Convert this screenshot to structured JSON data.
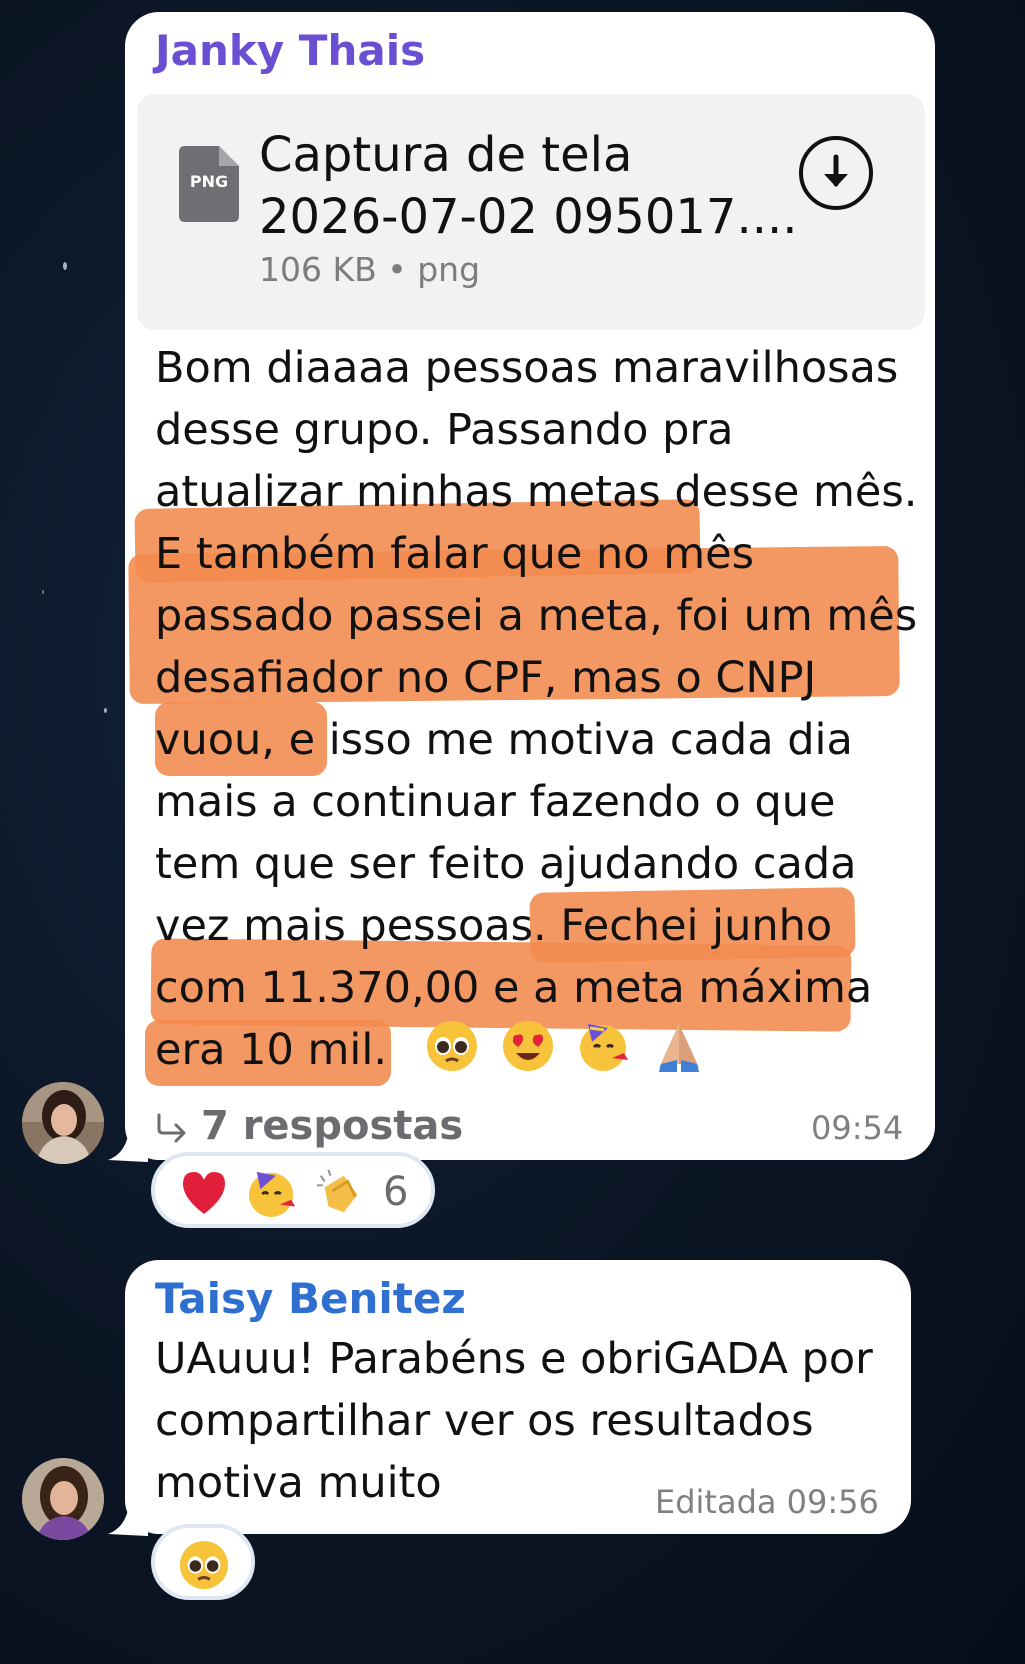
{
  "first_message": {
    "sender": "Janky Thais",
    "sender_color": "#6a4fd3",
    "attachment": {
      "badge": "PNG",
      "name_line1": "Captura de tela",
      "name_line2": "2026-07-02 095017....",
      "meta": "106 KB • png",
      "download_icon": "download-circle-icon"
    },
    "text_lines": [
      "Bom diaaaa pessoas maravilhosas",
      "desse grupo. Passando pra",
      "atualizar minhas metas desse mês.",
      "E também falar que no mês",
      "passado passei a meta, foi um mês",
      "desafiador no CPF, mas o CNPJ",
      "vuou, e isso me motiva cada dia",
      "mais a continuar fazendo o que",
      "tem que ser feito ajudando cada",
      "vez mais pessoas. Fechei junho",
      "com 11.370,00 e a meta máxima",
      "era 10 mil."
    ],
    "inline_emojis": [
      "pleading-face-emoji",
      "heart-eyes-emoji",
      "partying-face-emoji",
      "folded-hands-emoji"
    ],
    "replies_icon": "reply-arrow-icon",
    "replies_label": "7 respostas",
    "time": "09:54",
    "reactions": {
      "emojis": [
        "red-heart-emoji",
        "partying-face-emoji",
        "clapping-hands-emoji"
      ],
      "count": "6"
    }
  },
  "second_message": {
    "sender": "Taisy Benitez",
    "sender_color": "#2f6fd0",
    "text_lines": [
      "UAuuu! Parabéns e obriGADA por",
      "compartilhar ver os resultados",
      "motiva muito"
    ],
    "time": "Editada 09:56",
    "reactions": {
      "emojis": [
        "pleading-face-emoji"
      ]
    }
  },
  "colors": {
    "background": "#0c1727",
    "bubble": "#ffffff",
    "highlight": "#f28a4d",
    "attachment_bg": "#f2f2f3"
  }
}
